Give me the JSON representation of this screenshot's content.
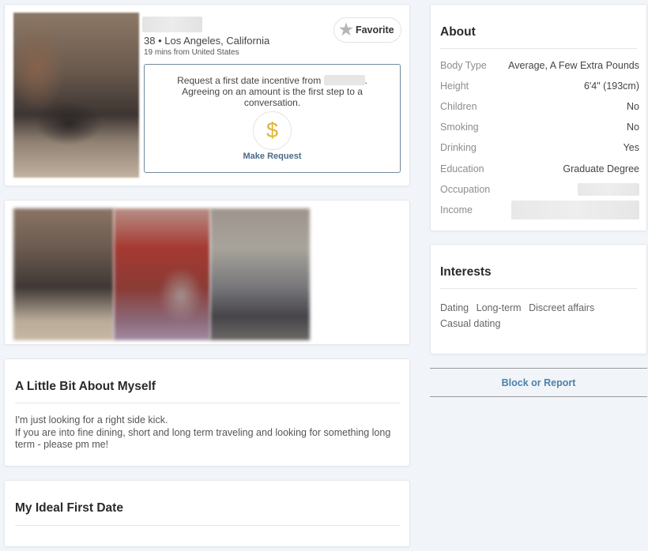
{
  "profile": {
    "age_location": "38 • Los Angeles, California",
    "last_seen": "19 mins from United States",
    "favorite_label": "Favorite",
    "request_text_before": "Request a first date incentive from ",
    "request_text_after": ". Agreeing on an amount is the first step to a conversation.",
    "dollar_symbol": "$",
    "make_request_label": "Make Request"
  },
  "about_myself": {
    "title": "A Little Bit About Myself",
    "line1": "I'm just looking for a right side kick.",
    "line2": "If you are into fine dining, short and long term traveling and looking for something long term - please pm me!"
  },
  "ideal_first_date": {
    "title": "My Ideal First Date"
  },
  "about": {
    "title": "About",
    "rows": [
      {
        "label": "Body Type",
        "value": "Average, A Few Extra Pounds"
      },
      {
        "label": "Height",
        "value": "6'4\" (193cm)"
      },
      {
        "label": "Children",
        "value": "No"
      },
      {
        "label": "Smoking",
        "value": "No"
      },
      {
        "label": "Drinking",
        "value": "Yes"
      },
      {
        "label": "Education",
        "value": "Graduate Degree"
      },
      {
        "label": "Occupation",
        "value": ""
      },
      {
        "label": "Income",
        "value": ""
      }
    ]
  },
  "interests": {
    "title": "Interests",
    "items": [
      "Dating",
      "Long-term",
      "Discreet affairs",
      "Casual dating"
    ]
  },
  "block_report_label": "Block or Report",
  "colors": {
    "accent_link": "#4a82ad",
    "dollar": "#e2b332",
    "request_link": "#4d6a86"
  }
}
